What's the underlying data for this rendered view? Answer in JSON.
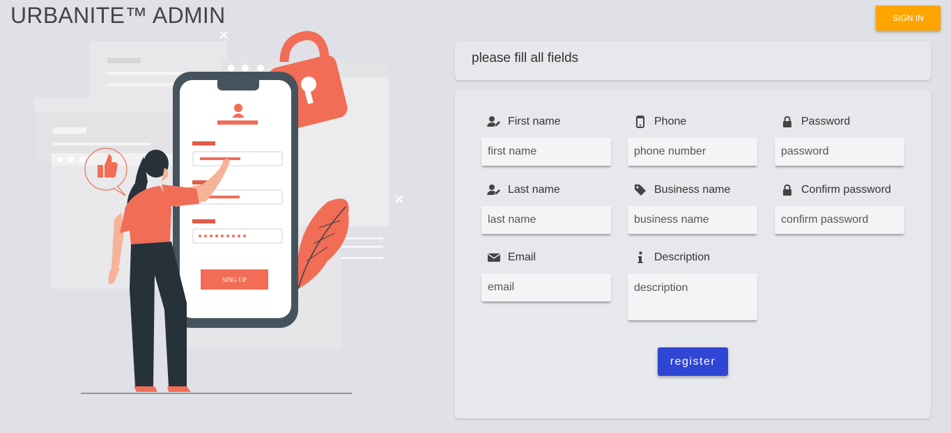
{
  "header": {
    "title": "URBANITE™ ADMIN",
    "sign_in_label": "SIGN IN"
  },
  "illustration": {
    "button_text": "SING UP",
    "accent_color": "#f26d56"
  },
  "notice": {
    "text": "please fill all fields"
  },
  "form": {
    "first_name": {
      "label": "First name",
      "placeholder": "first name",
      "value": ""
    },
    "phone": {
      "label": "Phone",
      "placeholder": "phone number",
      "value": ""
    },
    "password": {
      "label": "Password",
      "placeholder": "password",
      "value": ""
    },
    "last_name": {
      "label": "Last name",
      "placeholder": "last name",
      "value": ""
    },
    "business_name": {
      "label": "Business name",
      "placeholder": "business name",
      "value": ""
    },
    "confirm_password": {
      "label": "Confirm password",
      "placeholder": "confirm password",
      "value": ""
    },
    "email": {
      "label": "Email",
      "placeholder": "email",
      "value": ""
    },
    "description": {
      "label": "Description",
      "placeholder": "description",
      "value": ""
    },
    "register_label": "register"
  },
  "colors": {
    "background": "#dfe1e6",
    "card": "#e7e8eb",
    "sign_in": "#ffa500",
    "register": "#2f46d4"
  }
}
